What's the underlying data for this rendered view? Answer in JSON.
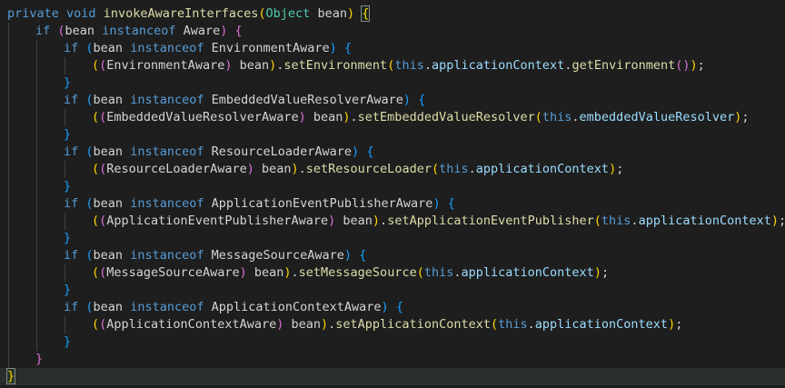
{
  "editor": {
    "language": "java",
    "theme": "dark",
    "colors": {
      "background": "#1e1e1e",
      "keyword": "#569cd6",
      "function": "#dcdcaa",
      "type": "#4ec9b0",
      "variable": "#9cdcfe",
      "bracket_level_1": "#ffd700",
      "bracket_level_2": "#da70d6",
      "bracket_level_3": "#179fff"
    },
    "lines": [
      {
        "indent": 0,
        "tokens": [
          [
            "kw",
            "private"
          ],
          [
            "pl",
            " "
          ],
          [
            "kw",
            "void"
          ],
          [
            "pl",
            " "
          ],
          [
            "fn",
            "invokeAwareInterfaces"
          ],
          [
            "b1",
            "("
          ],
          [
            "ty",
            "Object"
          ],
          [
            "pl",
            " bean"
          ],
          [
            "b1",
            ")"
          ],
          [
            "pl",
            " "
          ],
          [
            "b1hl",
            "{"
          ]
        ]
      },
      {
        "indent": 1,
        "tokens": [
          [
            "kw",
            "if"
          ],
          [
            "pl",
            " "
          ],
          [
            "b2",
            "("
          ],
          [
            "pl",
            "bean "
          ],
          [
            "kw",
            "instanceof"
          ],
          [
            "pl",
            " Aware"
          ],
          [
            "b2",
            ")"
          ],
          [
            "pl",
            " "
          ],
          [
            "b2",
            "{"
          ]
        ]
      },
      {
        "indent": 2,
        "tokens": [
          [
            "kw",
            "if"
          ],
          [
            "pl",
            " "
          ],
          [
            "b3",
            "("
          ],
          [
            "pl",
            "bean "
          ],
          [
            "kw",
            "instanceof"
          ],
          [
            "pl",
            " EnvironmentAware"
          ],
          [
            "b3",
            ")"
          ],
          [
            "pl",
            " "
          ],
          [
            "b3",
            "{"
          ]
        ]
      },
      {
        "indent": 3,
        "tokens": [
          [
            "b1",
            "("
          ],
          [
            "b2",
            "("
          ],
          [
            "pl",
            "EnvironmentAware"
          ],
          [
            "b2",
            ")"
          ],
          [
            "pl",
            " bean"
          ],
          [
            "b1",
            ")"
          ],
          [
            "pl",
            "."
          ],
          [
            "fn",
            "setEnvironment"
          ],
          [
            "b1",
            "("
          ],
          [
            "kw",
            "this"
          ],
          [
            "pl",
            "."
          ],
          [
            "va",
            "applicationContext"
          ],
          [
            "pl",
            "."
          ],
          [
            "fn",
            "getEnvironment"
          ],
          [
            "b2",
            "()"
          ],
          [
            "b1",
            ")"
          ],
          [
            "pl",
            ";"
          ]
        ]
      },
      {
        "indent": 2,
        "tokens": [
          [
            "b3",
            "}"
          ]
        ]
      },
      {
        "indent": 2,
        "tokens": [
          [
            "kw",
            "if"
          ],
          [
            "pl",
            " "
          ],
          [
            "b3",
            "("
          ],
          [
            "pl",
            "bean "
          ],
          [
            "kw",
            "instanceof"
          ],
          [
            "pl",
            " EmbeddedValueResolverAware"
          ],
          [
            "b3",
            ")"
          ],
          [
            "pl",
            " "
          ],
          [
            "b3",
            "{"
          ]
        ]
      },
      {
        "indent": 3,
        "tokens": [
          [
            "b1",
            "("
          ],
          [
            "b2",
            "("
          ],
          [
            "pl",
            "EmbeddedValueResolverAware"
          ],
          [
            "b2",
            ")"
          ],
          [
            "pl",
            " bean"
          ],
          [
            "b1",
            ")"
          ],
          [
            "pl",
            "."
          ],
          [
            "fn",
            "setEmbeddedValueResolver"
          ],
          [
            "b1",
            "("
          ],
          [
            "kw",
            "this"
          ],
          [
            "pl",
            "."
          ],
          [
            "va",
            "embeddedValueResolver"
          ],
          [
            "b1",
            ")"
          ],
          [
            "pl",
            ";"
          ]
        ]
      },
      {
        "indent": 2,
        "tokens": [
          [
            "b3",
            "}"
          ]
        ]
      },
      {
        "indent": 2,
        "tokens": [
          [
            "kw",
            "if"
          ],
          [
            "pl",
            " "
          ],
          [
            "b3",
            "("
          ],
          [
            "pl",
            "bean "
          ],
          [
            "kw",
            "instanceof"
          ],
          [
            "pl",
            " ResourceLoaderAware"
          ],
          [
            "b3",
            ")"
          ],
          [
            "pl",
            " "
          ],
          [
            "b3",
            "{"
          ]
        ]
      },
      {
        "indent": 3,
        "tokens": [
          [
            "b1",
            "("
          ],
          [
            "b2",
            "("
          ],
          [
            "pl",
            "ResourceLoaderAware"
          ],
          [
            "b2",
            ")"
          ],
          [
            "pl",
            " bean"
          ],
          [
            "b1",
            ")"
          ],
          [
            "pl",
            "."
          ],
          [
            "fn",
            "setResourceLoader"
          ],
          [
            "b1",
            "("
          ],
          [
            "kw",
            "this"
          ],
          [
            "pl",
            "."
          ],
          [
            "va",
            "applicationContext"
          ],
          [
            "b1",
            ")"
          ],
          [
            "pl",
            ";"
          ]
        ]
      },
      {
        "indent": 2,
        "tokens": [
          [
            "b3",
            "}"
          ]
        ]
      },
      {
        "indent": 2,
        "tokens": [
          [
            "kw",
            "if"
          ],
          [
            "pl",
            " "
          ],
          [
            "b3",
            "("
          ],
          [
            "pl",
            "bean "
          ],
          [
            "kw",
            "instanceof"
          ],
          [
            "pl",
            " ApplicationEventPublisherAware"
          ],
          [
            "b3",
            ")"
          ],
          [
            "pl",
            " "
          ],
          [
            "b3",
            "{"
          ]
        ]
      },
      {
        "indent": 3,
        "tokens": [
          [
            "b1",
            "("
          ],
          [
            "b2",
            "("
          ],
          [
            "pl",
            "ApplicationEventPublisherAware"
          ],
          [
            "b2",
            ")"
          ],
          [
            "pl",
            " bean"
          ],
          [
            "b1",
            ")"
          ],
          [
            "pl",
            "."
          ],
          [
            "fn",
            "setApplicationEventPublisher"
          ],
          [
            "b1",
            "("
          ],
          [
            "kw",
            "this"
          ],
          [
            "pl",
            "."
          ],
          [
            "va",
            "applicationContext"
          ],
          [
            "b1",
            ")"
          ],
          [
            "pl",
            ";"
          ]
        ]
      },
      {
        "indent": 2,
        "tokens": [
          [
            "b3",
            "}"
          ]
        ]
      },
      {
        "indent": 2,
        "tokens": [
          [
            "kw",
            "if"
          ],
          [
            "pl",
            " "
          ],
          [
            "b3",
            "("
          ],
          [
            "pl",
            "bean "
          ],
          [
            "kw",
            "instanceof"
          ],
          [
            "pl",
            " MessageSourceAware"
          ],
          [
            "b3",
            ")"
          ],
          [
            "pl",
            " "
          ],
          [
            "b3",
            "{"
          ]
        ]
      },
      {
        "indent": 3,
        "tokens": [
          [
            "b1",
            "("
          ],
          [
            "b2",
            "("
          ],
          [
            "pl",
            "MessageSourceAware"
          ],
          [
            "b2",
            ")"
          ],
          [
            "pl",
            " bean"
          ],
          [
            "b1",
            ")"
          ],
          [
            "pl",
            "."
          ],
          [
            "fn",
            "setMessageSource"
          ],
          [
            "b1",
            "("
          ],
          [
            "kw",
            "this"
          ],
          [
            "pl",
            "."
          ],
          [
            "va",
            "applicationContext"
          ],
          [
            "b1",
            ")"
          ],
          [
            "pl",
            ";"
          ]
        ]
      },
      {
        "indent": 2,
        "tokens": [
          [
            "b3",
            "}"
          ]
        ]
      },
      {
        "indent": 2,
        "tokens": [
          [
            "kw",
            "if"
          ],
          [
            "pl",
            " "
          ],
          [
            "b3",
            "("
          ],
          [
            "pl",
            "bean "
          ],
          [
            "kw",
            "instanceof"
          ],
          [
            "pl",
            " ApplicationContextAware"
          ],
          [
            "b3",
            ")"
          ],
          [
            "pl",
            " "
          ],
          [
            "b3",
            "{"
          ]
        ]
      },
      {
        "indent": 3,
        "tokens": [
          [
            "b1",
            "("
          ],
          [
            "b2",
            "("
          ],
          [
            "pl",
            "ApplicationContextAware"
          ],
          [
            "b2",
            ")"
          ],
          [
            "pl",
            " bean"
          ],
          [
            "b1",
            ")"
          ],
          [
            "pl",
            "."
          ],
          [
            "fn",
            "setApplicationContext"
          ],
          [
            "b1",
            "("
          ],
          [
            "kw",
            "this"
          ],
          [
            "pl",
            "."
          ],
          [
            "va",
            "applicationContext"
          ],
          [
            "b1",
            ")"
          ],
          [
            "pl",
            ";"
          ]
        ]
      },
      {
        "indent": 2,
        "tokens": [
          [
            "b3",
            "}"
          ]
        ]
      },
      {
        "indent": 1,
        "tokens": [
          [
            "b2",
            "}"
          ]
        ]
      },
      {
        "indent": 0,
        "tokens": [
          [
            "b1hl",
            "}"
          ]
        ]
      }
    ]
  }
}
